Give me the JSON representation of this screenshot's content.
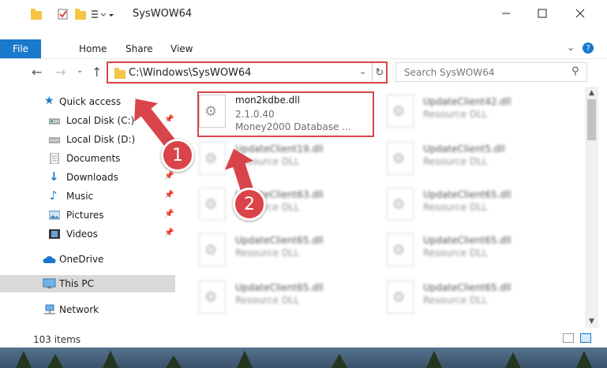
{
  "window": {
    "title": "SysWOW64",
    "minimize_icon": "minimize-icon",
    "maximize_icon": "maximize-icon",
    "close_icon": "close-icon"
  },
  "ribbon": {
    "tabs": [
      "File",
      "Home",
      "Share",
      "View"
    ],
    "help": "?"
  },
  "nav": {
    "address": "C:\\Windows\\SysWOW64",
    "search_placeholder": "Search SysWOW64"
  },
  "sidebar": {
    "items": [
      {
        "label": "Quick access",
        "icon": "star-icon",
        "pinned": false
      },
      {
        "label": "Local Disk (C:)",
        "icon": "drive-icon",
        "pinned": true
      },
      {
        "label": "Local Disk (D:)",
        "icon": "drive-icon",
        "pinned": false
      },
      {
        "label": "Documents",
        "icon": "documents-icon",
        "pinned": true
      },
      {
        "label": "Downloads",
        "icon": "download-icon",
        "pinned": true
      },
      {
        "label": "Music",
        "icon": "music-icon",
        "pinned": true
      },
      {
        "label": "Pictures",
        "icon": "pictures-icon",
        "pinned": true
      },
      {
        "label": "Videos",
        "icon": "videos-icon",
        "pinned": true
      },
      {
        "label": "OneDrive",
        "icon": "cloud-icon",
        "pinned": false
      },
      {
        "label": "This PC",
        "icon": "computer-icon",
        "pinned": false,
        "selected": true
      },
      {
        "label": "Network",
        "icon": "network-icon",
        "pinned": false
      }
    ]
  },
  "files": {
    "highlighted": {
      "name": "mon2kdbe.dll",
      "version": "2.1.0.40",
      "description": "Money2000 Database ..."
    },
    "tiles": [
      {
        "name": "UpdateClient42.dll",
        "type": "Resource DLL"
      },
      {
        "name": "UpdateClient19.dll",
        "type": "Resource DLL"
      },
      {
        "name": "UpdateClient5.dll",
        "type": "Resource DLL"
      },
      {
        "name": "UpdateClient63.dll",
        "type": "Resource DLL"
      },
      {
        "name": "UpdateClient65.dll",
        "type": "Resource DLL"
      },
      {
        "name": "UpdateClient65.dll",
        "type": "Resource DLL"
      },
      {
        "name": "UpdateClient65.dll",
        "type": "Resource DLL"
      },
      {
        "name": "UpdateClient65.dll",
        "type": "Resource DLL"
      },
      {
        "name": "UpdateClient65.dll",
        "type": "Resource DLL"
      }
    ]
  },
  "status": {
    "item_count": "103 items"
  },
  "annotations": {
    "step1": "1",
    "step2": "2"
  },
  "colors": {
    "accent": "#1979ca",
    "highlight": "#d9444a",
    "folder": "#f6c443"
  }
}
